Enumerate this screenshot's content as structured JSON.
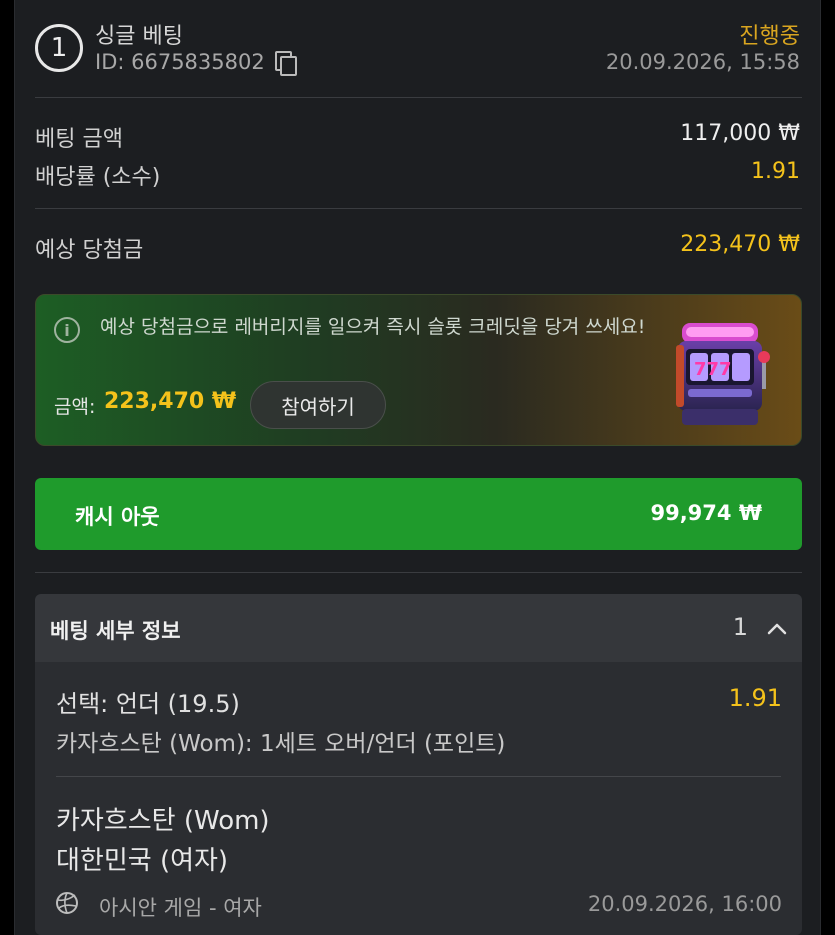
{
  "bet": {
    "number": "1",
    "type_label": "싱글 베팅",
    "id_label": "ID: 6675835802",
    "status": "진행중",
    "datetime": "20.09.2026, 15:58"
  },
  "summary": {
    "stake_label": "베팅 금액",
    "stake_value": "117,000 ₩",
    "odds_label": "배당률 (소수)",
    "odds_value": "1.91",
    "potential_label": "예상 당첨금",
    "potential_value": "223,470 ₩"
  },
  "promo": {
    "text": "예상 당첨금으로 레버리지를 일으켜 즉시 슬롯 크레딧을 당겨 쓰세요!",
    "amount_label": "금액:",
    "amount_value": "223,470 ₩",
    "button_label": "참여하기",
    "slot_text": "777"
  },
  "cashout": {
    "label": "캐시 아웃",
    "value": "99,974 ₩"
  },
  "details": {
    "title": "베팅 세부 정보",
    "count": "1",
    "selection": "선택: 언더 (19.5)",
    "selection_odds": "1.91",
    "market": "카자흐스탄 (Wom): 1세트 오버/언더 (포인트)",
    "team_home": "카자흐스탄 (Wom)",
    "team_away": "대한민국 (여자)",
    "league": "아시안 게임 - 여자",
    "event_time": "20.09.2026, 16:00"
  },
  "colors": {
    "accent_yellow": "#f4c21b",
    "status_orange": "#d9a520",
    "cashout_green": "#1f9b2c",
    "panel_bg": "#1c1e21"
  }
}
